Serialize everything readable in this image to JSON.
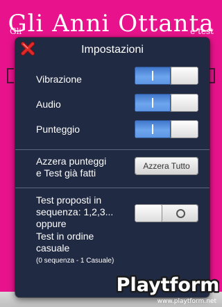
{
  "background": {
    "title": "Gli Anni Ottanta",
    "small_left": "Gli",
    "small_right": "e test"
  },
  "dialog": {
    "title": "Impostazioni",
    "close_icon": "red-x-close-icon",
    "settings": [
      {
        "label": "Vibrazione",
        "state": "on"
      },
      {
        "label": "Audio",
        "state": "on"
      },
      {
        "label": "Punteggio",
        "state": "on"
      }
    ],
    "reset": {
      "label_line1": "Azzera punteggi",
      "label_line2": "e Test già fatti",
      "button_label": "Azzera Tutto"
    },
    "order": {
      "label_lines": [
        "Test proposti in",
        "sequenza: 1,2,3...",
        "oppure",
        "Test in ordine",
        "casuale"
      ],
      "note": "(0 sequenza - 1 Casuale)",
      "state": "off"
    }
  },
  "watermark": {
    "logo_text": "Playtform",
    "url": "www.playtform.net"
  },
  "colors": {
    "background": "#e8138c",
    "dialog": "#202a43",
    "toggle_on": "#5c95e4",
    "close_icon": "#d42020"
  }
}
